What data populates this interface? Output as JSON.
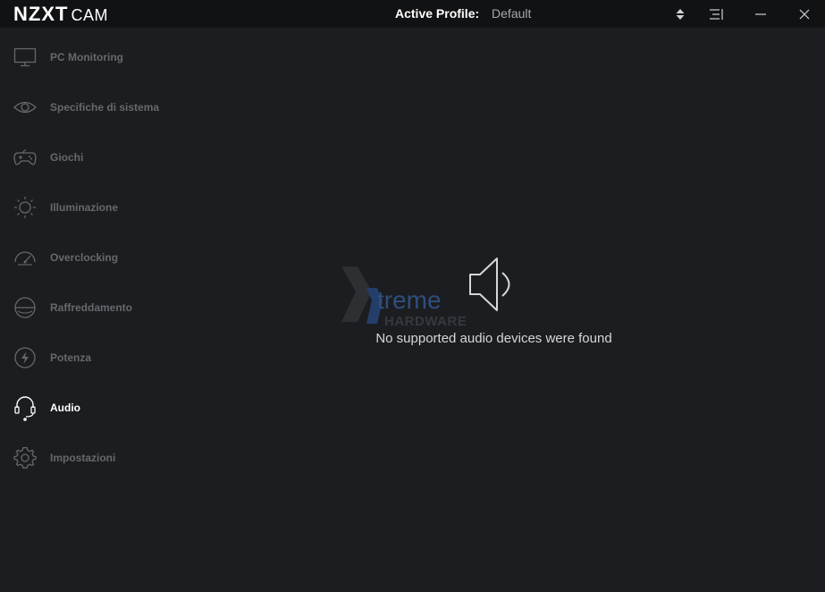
{
  "app": {
    "brand_main": "NZXT",
    "brand_sub": "CAM"
  },
  "header": {
    "profile_label": "Active Profile:",
    "profile_value": "Default",
    "icons": [
      "sort-arrows-icon",
      "menu-icon",
      "minimize-icon",
      "close-icon"
    ]
  },
  "sidebar": {
    "items": [
      {
        "label": "PC Monitoring",
        "icon": "monitor-icon",
        "active": false
      },
      {
        "label": "Specifiche di sistema",
        "icon": "eye-icon",
        "active": false
      },
      {
        "label": "Giochi",
        "icon": "gamepad-icon",
        "active": false
      },
      {
        "label": "Illuminazione",
        "icon": "sun-icon",
        "active": false
      },
      {
        "label": "Overclocking",
        "icon": "gauge-icon",
        "active": false
      },
      {
        "label": "Raffreddamento",
        "icon": "fan-icon",
        "active": false
      },
      {
        "label": "Potenza",
        "icon": "lightning-icon",
        "active": false
      },
      {
        "label": "Audio",
        "icon": "headset-icon",
        "active": true
      },
      {
        "label": "Impostazioni",
        "icon": "gear-icon",
        "active": false
      }
    ]
  },
  "main": {
    "empty_message": "No supported audio devices were found",
    "empty_icon": "speaker-icon"
  },
  "watermark": {
    "line1": "treme",
    "line2": "HARDWARE"
  },
  "colors": {
    "background": "#1c1d20",
    "titlebar": "#111214",
    "nav_inactive": "#66686c",
    "nav_active": "#ffffff"
  }
}
